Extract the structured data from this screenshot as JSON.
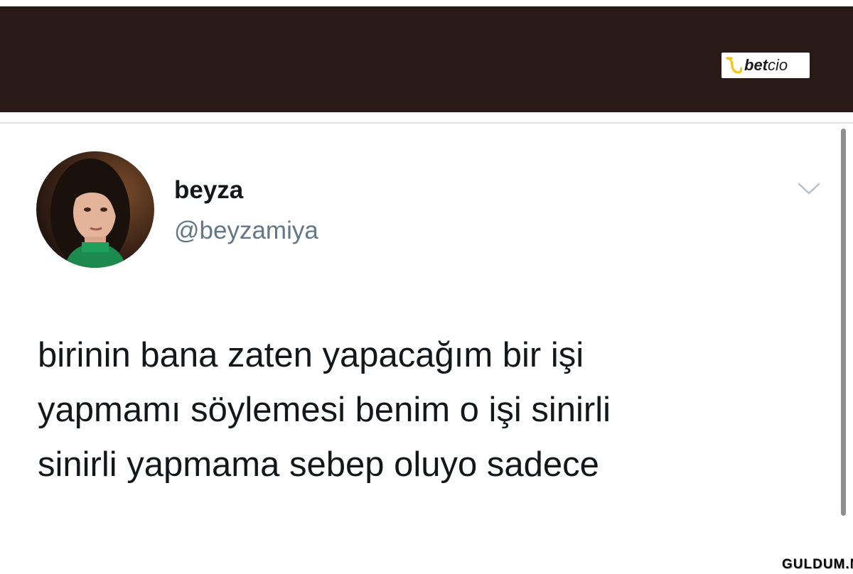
{
  "banner": {
    "background": "#2a1a17",
    "logo_text_bold": "bet",
    "logo_text_light": "cio",
    "logo_color": "#f2c414"
  },
  "tweet": {
    "display_name": "beyza",
    "handle": "@beyzamiya",
    "text_lines": [
      "birinin bana zaten yapacağım bir işi",
      "yapmamı söylemesi benim o işi sinirli",
      "sinirli yapmama sebep oluyo sadece"
    ],
    "menu_icon": "chevron-down-icon",
    "name_color": "#14171a",
    "handle_color": "#657786"
  },
  "watermark": {
    "text": "GULDUM.NET"
  }
}
